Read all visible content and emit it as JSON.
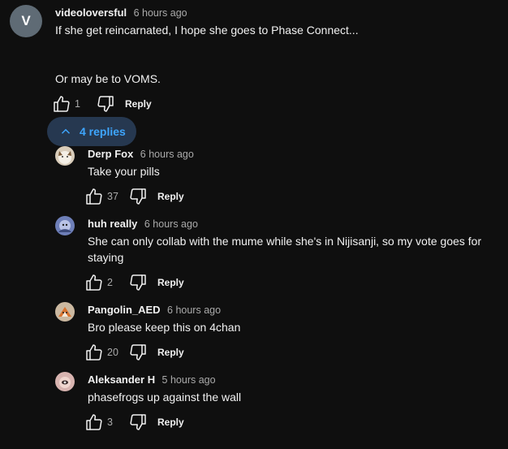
{
  "comment": {
    "avatar_letter": "V",
    "author": "videoloversful",
    "time": "6 hours ago",
    "text_line1": "If she get reincarnated, I hope she goes to Phase Connect...",
    "text_line2": "Or may be to VOMS.",
    "likes": "1",
    "reply_label": "Reply"
  },
  "replies_toggle": {
    "label": "4 replies",
    "icon": "chevron-up-icon"
  },
  "replies": [
    {
      "author": "Derp Fox",
      "time": "6 hours ago",
      "text": "Take your pills",
      "likes": "37",
      "reply_label": "Reply"
    },
    {
      "author": "huh really",
      "time": "6 hours ago",
      "text_line1": "She can only collab with the mume while she's in Nijisanji, so my vote goes for",
      "text_line2": "staying",
      "likes": "2",
      "reply_label": "Reply"
    },
    {
      "author": "Pangolin_AED",
      "time": "6 hours ago",
      "text": "Bro please keep this on 4chan",
      "likes": "20",
      "reply_label": "Reply"
    },
    {
      "author": "Aleksander H",
      "time": "5 hours ago",
      "text": "phasefrogs up against the wall",
      "likes": "3",
      "reply_label": "Reply"
    }
  ],
  "colors": {
    "background": "#0f0f0f",
    "replies_toggle_bg": "#263850",
    "link_blue": "#3ea6ff"
  }
}
